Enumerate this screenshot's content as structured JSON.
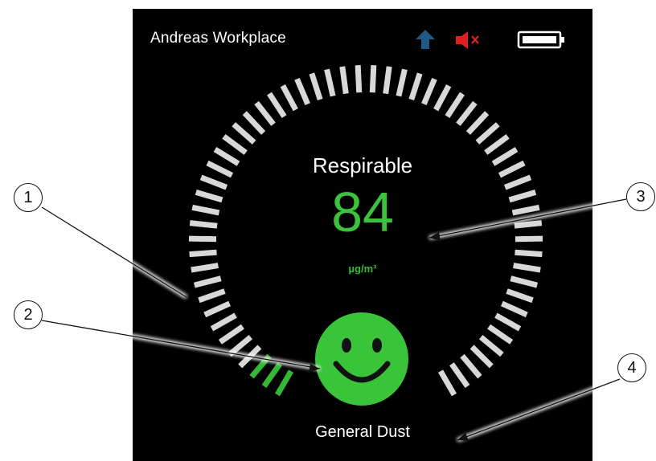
{
  "header": {
    "title": "Andreas Workplace",
    "upload_icon": "upload-arrow-icon",
    "mute_icon": "speaker-muted-icon",
    "battery_icon": "battery-icon"
  },
  "gauge": {
    "label": "Respirable",
    "value": "84",
    "unit": "µg/m³",
    "level_fraction": 0.05,
    "segment_count": 60,
    "lit_segments": 3,
    "color_active": "#35b835",
    "color_inactive": "#d8d8d8",
    "value_color": "#3cc33c"
  },
  "status": {
    "icon": "smiley-face-icon",
    "color": "#39c439"
  },
  "profile": {
    "name": "General Dust"
  },
  "callouts": [
    "1",
    "2",
    "3",
    "4"
  ]
}
